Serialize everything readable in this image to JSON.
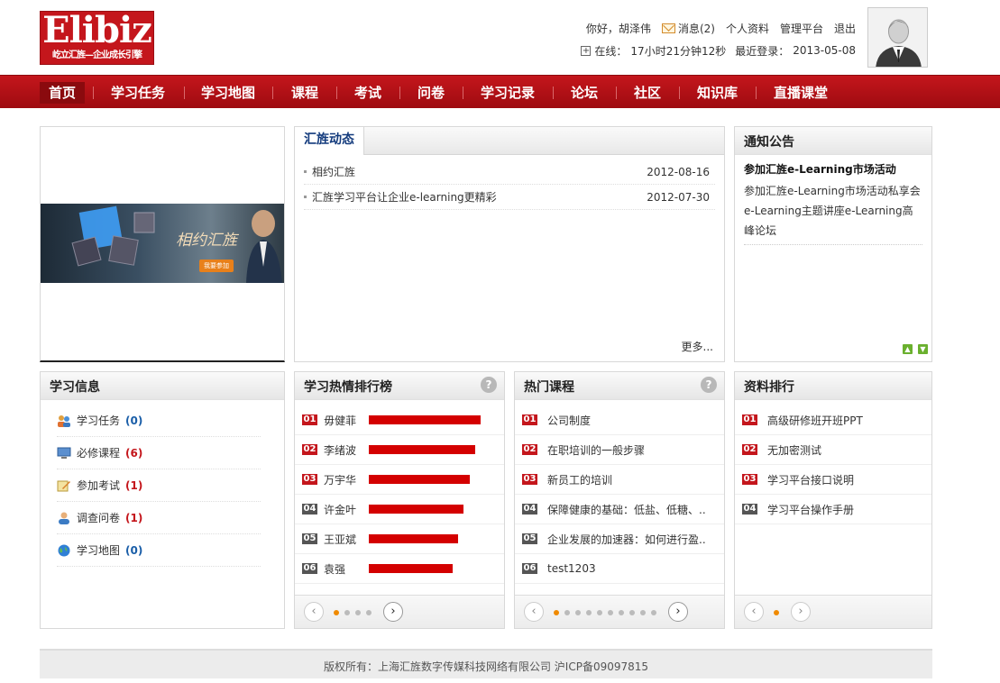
{
  "header": {
    "logo_main": "Elibiz",
    "logo_sub": "屹立汇旌—企业成长引擎",
    "greeting": "你好，",
    "user_name": "胡泽伟",
    "messages": "消息(2)",
    "profile": "个人资料",
    "admin": "管理平台",
    "logout": "退出",
    "online_label": "在线：",
    "online_time": "17小时21分钟12秒",
    "last_login_label": "最近登录：",
    "last_login": "2013-05-08"
  },
  "nav": [
    "首页",
    "学习任务",
    "学习地图",
    "课程",
    "考试",
    "问卷",
    "学习记录",
    "论坛",
    "社区",
    "知识库",
    "直播课堂"
  ],
  "banner": {
    "text": "相约汇旌",
    "button": "我要参加"
  },
  "news": {
    "tab": "汇旌动态",
    "items": [
      {
        "title": "相约汇旌",
        "date": "2012-08-16"
      },
      {
        "title": "汇旌学习平台让企业e-learning更精彩",
        "date": "2012-07-30"
      }
    ],
    "more": "更多..."
  },
  "notice": {
    "title": "通知公告",
    "item_title": "参加汇旌e-Learning市场活动",
    "item_body": "参加汇旌e-Learning市场活动私享会e-Learning主题讲座e-Learning高峰论坛"
  },
  "study_info": {
    "title": "学习信息",
    "items": [
      {
        "label": "学习任务",
        "count": "(0)",
        "color": "#1a5ea8"
      },
      {
        "label": "必修课程",
        "count": "(6)",
        "color": "#c4161c"
      },
      {
        "label": "参加考试",
        "count": "(1)",
        "color": "#c4161c"
      },
      {
        "label": "调查问卷",
        "count": "(1)",
        "color": "#c4161c"
      },
      {
        "label": "学习地图",
        "count": "(0)",
        "color": "#1a5ea8"
      }
    ]
  },
  "ranking": {
    "title": "学习热情排行榜",
    "items": [
      {
        "num": "01",
        "name": "毋健菲",
        "score": 1.0
      },
      {
        "num": "02",
        "name": "李绪波",
        "score": 0.95
      },
      {
        "num": "03",
        "name": "万宇华",
        "score": 0.9
      },
      {
        "num": "04",
        "name": "许金叶",
        "score": 0.85
      },
      {
        "num": "05",
        "name": "王亚斌",
        "score": 0.8
      },
      {
        "num": "06",
        "name": "袁强",
        "score": 0.75
      }
    ]
  },
  "hot_courses": {
    "title": "热门课程",
    "items": [
      {
        "num": "01",
        "name": "公司制度"
      },
      {
        "num": "02",
        "name": "在职培训的一般步骤"
      },
      {
        "num": "03",
        "name": "新员工的培训"
      },
      {
        "num": "04",
        "name": "保障健康的基础：低盐、低糖、.."
      },
      {
        "num": "05",
        "name": "企业发展的加速器：如何进行盈.."
      },
      {
        "num": "06",
        "name": "test1203"
      }
    ]
  },
  "resources": {
    "title": "资料排行",
    "items": [
      {
        "num": "01",
        "name": "高级研修班开班PPT"
      },
      {
        "num": "02",
        "name": "无加密测试"
      },
      {
        "num": "03",
        "name": "学习平台接口说明"
      },
      {
        "num": "04",
        "name": "学习平台操作手册"
      }
    ]
  },
  "footer": "版权所有：上海汇旌数字传媒科技网络有限公司 沪ICP备09097815",
  "colors": {
    "brand_red": "#c4161c",
    "rank_top": "#c4161c",
    "rank_other": "#555555",
    "dot_active": "#f08a00"
  }
}
